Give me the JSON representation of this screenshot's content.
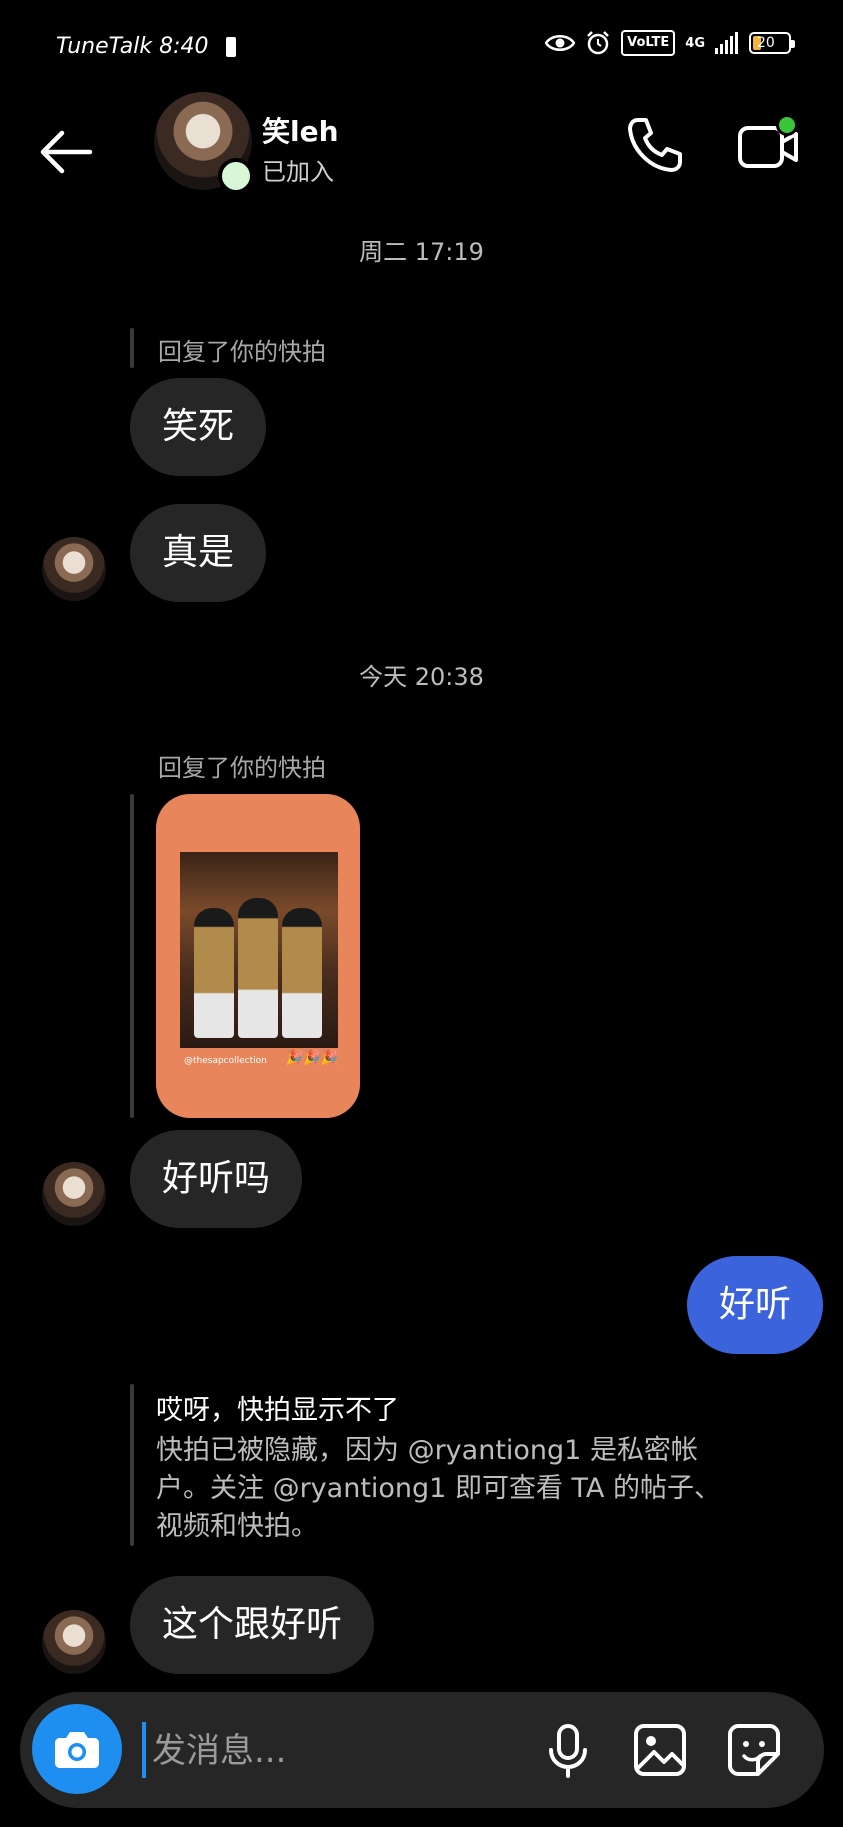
{
  "status_bar": {
    "carrier": "TuneTalk",
    "time": "8:40",
    "volte": "VoLTE",
    "network": "4G",
    "battery": "20",
    "battery_fraction": 0.2
  },
  "header": {
    "name": "笑leh",
    "subtitle": "已加入"
  },
  "messages": {
    "ts1": "周二 17:19",
    "reply1_label": "回复了你的快拍",
    "msg1": "笑死",
    "msg2": "真是",
    "ts2": "今天 20:38",
    "reply2_label": "回复了你的快拍",
    "story_tag": "@thesapcollection",
    "story_emoji": "🎉🎉🎉",
    "msg3": "好听吗",
    "msg4": "好听",
    "notice_title": "哎呀，快拍显示不了",
    "notice_body": "快拍已被隐藏，因为 @ryantiong1 是私密帐户。关注 @ryantiong1 即可查看 TA 的帖子、视频和快拍。",
    "msg5": "这个跟好听"
  },
  "composer": {
    "placeholder": "发消息..."
  },
  "colors": {
    "background": "#000000",
    "bubble_them": "#262626",
    "bubble_me": "#3b64dc",
    "camera_button": "#1e8ef0",
    "online": "#3ac53a"
  }
}
